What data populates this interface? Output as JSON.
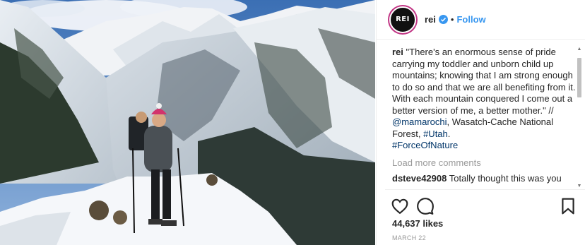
{
  "post": {
    "username": "rei",
    "avatar_text": "REI",
    "follow_label": "Follow",
    "separator": "•",
    "caption": {
      "user": "rei",
      "text_main": "\"There's an enormous sense of pride carrying my toddler and unborn child up mountains; knowing that I am strong enough to do so and that we are all benefiting from it. With each mountain conquered I come out a better version of me, a better mother.\" // ",
      "mention": "@mamarochi",
      "location_text": ", Wasatch-Cache National Forest, ",
      "tag_utah": "#Utah",
      "tag_end": ".",
      "tag_force": "#ForceOfNature"
    },
    "load_more": "Load more comments",
    "comment": {
      "user": "dsteve42908",
      "text": "Totally thought this was you"
    },
    "likes": "44,637 likes",
    "date": "MARCH 22"
  },
  "icons": {
    "verified": "verified-badge-icon",
    "like": "heart-icon",
    "comment": "comment-icon",
    "save": "bookmark-icon"
  },
  "colors": {
    "link": "#3897f0",
    "mention": "#003569",
    "muted": "#999999"
  }
}
